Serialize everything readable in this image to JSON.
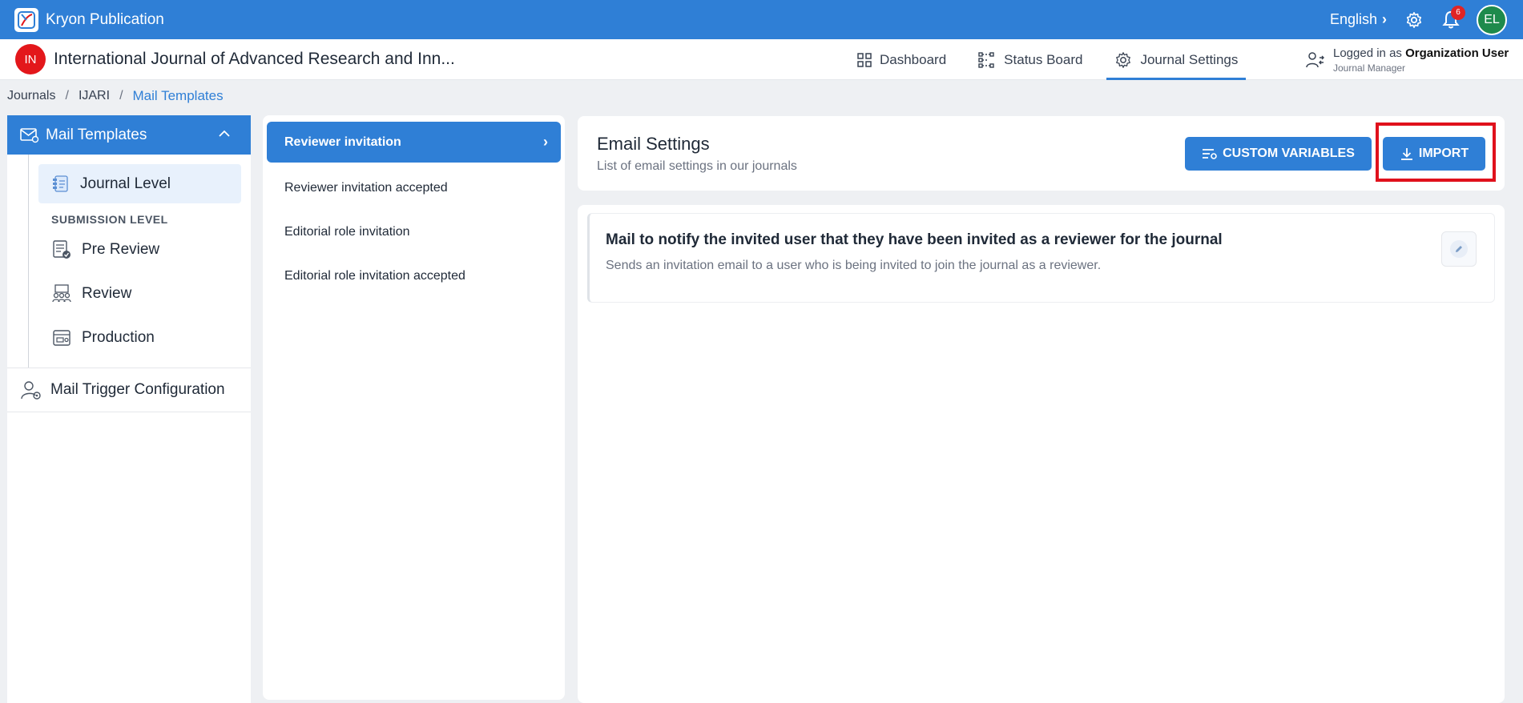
{
  "app": {
    "name": "Kryon Publication",
    "language": "English",
    "notification_count": "6",
    "user_initials": "EL"
  },
  "journal": {
    "initials": "IN",
    "title": "International Journal of Advanced Research and Inn..."
  },
  "nav": {
    "dashboard": "Dashboard",
    "status_board": "Status Board",
    "journal_settings": "Journal Settings"
  },
  "user": {
    "logged_in_prefix": "Logged in as",
    "name": "Organization User",
    "role": "Journal Manager"
  },
  "breadcrumb": {
    "items": [
      "Journals",
      "IJARI",
      "Mail Templates"
    ],
    "separator": "/"
  },
  "sidebar": {
    "header": "Mail Templates",
    "journal_level": "Journal Level",
    "section_label": "SUBMISSION LEVEL",
    "items": [
      "Pre Review",
      "Review",
      "Production"
    ],
    "trigger": "Mail Trigger Configuration"
  },
  "templates": {
    "items": [
      "Reviewer invitation",
      "Reviewer invitation accepted",
      "Editorial role invitation",
      "Editorial role invitation accepted"
    ]
  },
  "settings": {
    "title": "Email Settings",
    "subtitle": "List of email settings in our journals",
    "custom_variables": "CUSTOM VARIABLES",
    "import": "IMPORT"
  },
  "mail": {
    "title": "Mail to notify the invited user that they have been invited as a reviewer for the journal",
    "description": "Sends an invitation email to a user who is being invited to join the journal as a reviewer."
  },
  "colors": {
    "primary": "#2f7fd6",
    "highlight": "#e0111c",
    "journal_badge": "#e3171b",
    "avatar": "#1e8a4c"
  }
}
